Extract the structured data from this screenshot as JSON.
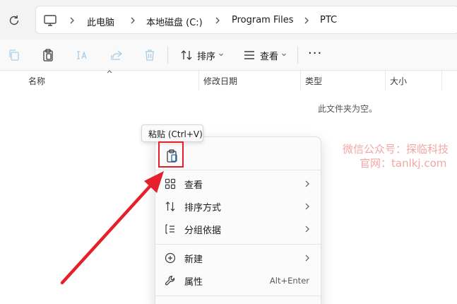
{
  "address": {
    "crumbs": [
      "此电脑",
      "本地磁盘 (C:)",
      "Program Files",
      "PTC"
    ]
  },
  "commands": {
    "sort_label": "排序",
    "view_label": "查看",
    "more_label": "···"
  },
  "columns": {
    "name": "名称",
    "modified": "修改日期",
    "type": "类型",
    "size": "大小"
  },
  "empty_message": "此文件夹为空。",
  "tooltip": "粘贴 (Ctrl+V)",
  "context_menu": {
    "items": [
      {
        "label": "查看",
        "icon": "view-grid-icon",
        "submenu": true
      },
      {
        "label": "排序方式",
        "icon": "sort-icon",
        "submenu": true
      },
      {
        "label": "分组依据",
        "icon": "group-icon",
        "submenu": true
      },
      {
        "label": "新建",
        "icon": "new-plus-icon",
        "submenu": true
      },
      {
        "label": "属性",
        "icon": "wrench-icon",
        "shortcut": "Alt+Enter"
      }
    ]
  },
  "watermark": {
    "line1": "微信公众号：探临科技",
    "line2": "官网：tanlkj.com"
  },
  "colors": {
    "accent": "#0067c0",
    "highlight": "#e5202a",
    "watermark": "#f3a6a6"
  }
}
